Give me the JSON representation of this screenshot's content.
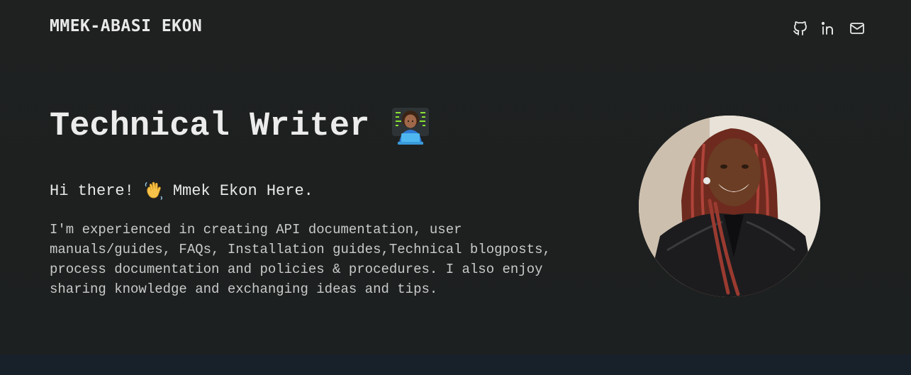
{
  "header": {
    "logo_text": "MMEK-ABASI EKON",
    "social_links": [
      {
        "icon": "github-icon",
        "label": "GitHub"
      },
      {
        "icon": "linkedin-icon",
        "label": "LinkedIn"
      },
      {
        "icon": "mail-icon",
        "label": "Email"
      }
    ]
  },
  "hero": {
    "headline": "Technical Writer",
    "headline_emoji": "technologist-emoji",
    "greeting_before": "Hi there!",
    "greeting_emoji": "waving-hand-emoji",
    "greeting_after": "Mmek Ekon Here.",
    "bio": "I'm experienced in creating API documentation, user manuals/guides, FAQs, Installation guides,Technical blogposts, process documentation and policies & procedures. I also enjoy sharing knowledge and exchanging ideas and tips."
  },
  "colors": {
    "background": "#1d2020",
    "bottom_band": "#18202a",
    "text_primary": "#ececec",
    "text_secondary": "#c9c9c9"
  }
}
